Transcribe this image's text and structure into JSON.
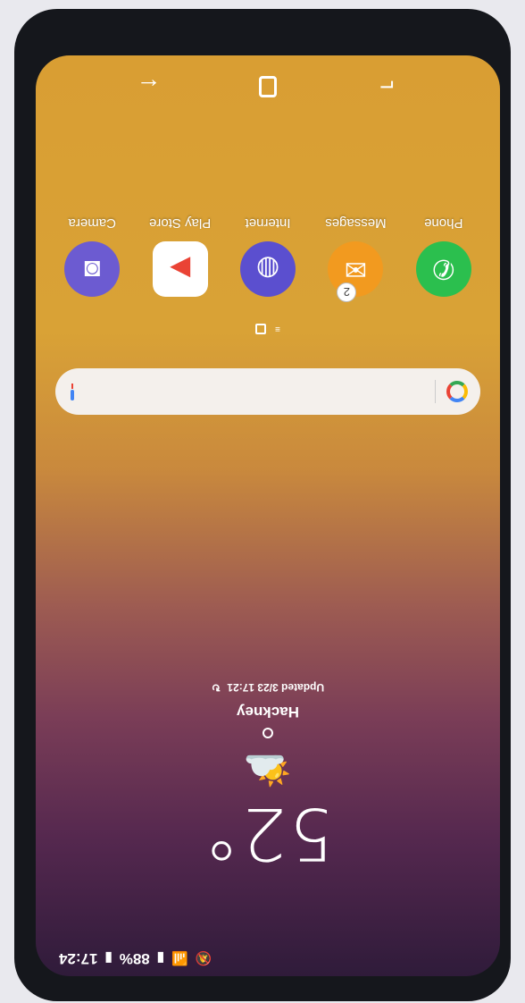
{
  "status_bar": {
    "time": "17:24",
    "battery": "88%",
    "signal_icon": "signal-icon",
    "wifi_icon": "wifi-icon",
    "mute_icon": "mute-icon"
  },
  "weather": {
    "temperature": "52°",
    "location": "Hackney",
    "updated": "Updated 3/23 17:21",
    "icon": "partly-cloudy-icon",
    "refresh_icon": "refresh-icon"
  },
  "search": {
    "logo": "google-icon",
    "mic_icon": "mic-icon"
  },
  "dock": [
    {
      "label": "Phone",
      "icon": "phone-icon",
      "color": "#2bbf4e"
    },
    {
      "label": "Messages",
      "icon": "messages-icon",
      "color": "#f29a1f",
      "badge": "2"
    },
    {
      "label": "Internet",
      "icon": "internet-icon",
      "color": "#5b4fcf"
    },
    {
      "label": "Play Store",
      "icon": "play-store-icon",
      "color": "#ffffff"
    },
    {
      "label": "Camera",
      "icon": "camera-icon",
      "color": "#6c5bd1"
    }
  ],
  "nav": {
    "recents": "recents-icon",
    "home": "home-icon",
    "back": "back-icon"
  }
}
